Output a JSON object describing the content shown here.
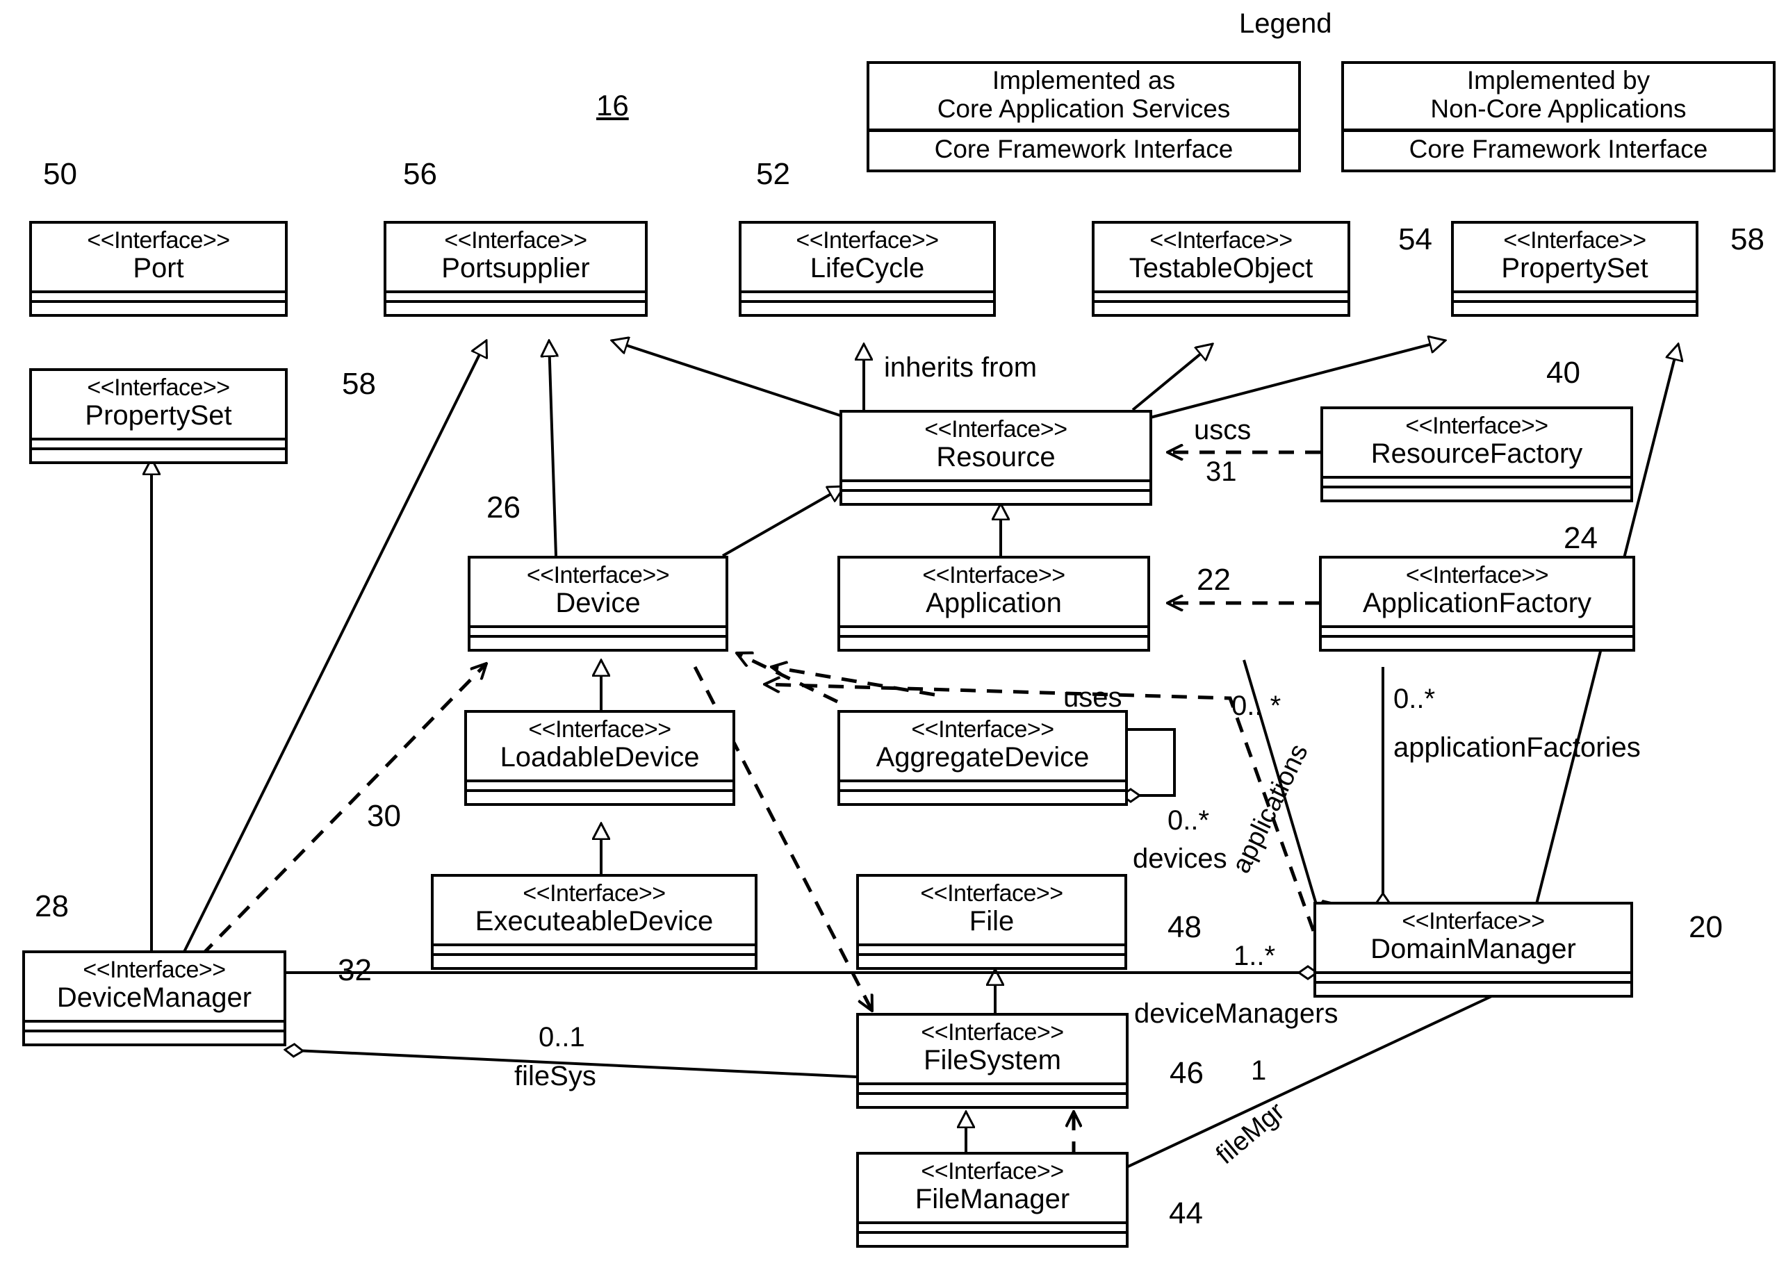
{
  "figure": {
    "number": "16"
  },
  "legend": {
    "title": "Legend",
    "boxes": [
      {
        "line1": "Implemented as",
        "line2": "Core Application Services",
        "footer": "Core Framework Interface"
      },
      {
        "line1": "Implemented by",
        "line2": "Non-Core Applications",
        "footer": "Core Framework Interface"
      }
    ]
  },
  "stereotype": "<<Interface>>",
  "interfaces": [
    {
      "id": "port",
      "name": "Port",
      "ref": "50"
    },
    {
      "id": "portsupplier",
      "name": "Portsupplier",
      "ref": "56"
    },
    {
      "id": "lifecycle",
      "name": "LifeCycle",
      "ref": "52"
    },
    {
      "id": "testableobject",
      "name": "TestableObject",
      "ref": "54"
    },
    {
      "id": "propertyset-right",
      "name": "PropertySet",
      "ref": "58"
    },
    {
      "id": "propertyset-left",
      "name": "PropertySet",
      "ref": "58"
    },
    {
      "id": "resource",
      "name": "Resource",
      "ref": ""
    },
    {
      "id": "resourcefactory",
      "name": "ResourceFactory",
      "ref": "40"
    },
    {
      "id": "device",
      "name": "Device",
      "ref": "26"
    },
    {
      "id": "application",
      "name": "Application",
      "ref": "22"
    },
    {
      "id": "applicationfactory",
      "name": "ApplicationFactory",
      "ref": "24"
    },
    {
      "id": "loadabledevice",
      "name": "LoadableDevice",
      "ref": "30"
    },
    {
      "id": "aggregatedevice",
      "name": "AggregateDevice",
      "ref": ""
    },
    {
      "id": "executeabledevice",
      "name": "ExecuteableDevice",
      "ref": "32"
    },
    {
      "id": "file",
      "name": "File",
      "ref": "48"
    },
    {
      "id": "domainmanager",
      "name": "DomainManager",
      "ref": "20"
    },
    {
      "id": "devicemanager",
      "name": "DeviceManager",
      "ref": "28"
    },
    {
      "id": "filesystem",
      "name": "FileSystem",
      "ref": "46"
    },
    {
      "id": "filemanager",
      "name": "FileManager",
      "ref": "44"
    }
  ],
  "edge_labels": {
    "inherits_from": "inherits from",
    "uses_resource": "uscs",
    "uses_resource_ref": "31",
    "uses_aggregate": "uses",
    "devices_mult": "0..*",
    "devices_role": "devices",
    "applications_mult": "0.. *",
    "applications_role": "applications",
    "application_factories_mult": "0..*",
    "application_factories_role": "applicationFactories",
    "device_managers_mult": "1..*",
    "device_managers_role": "deviceManagers",
    "file_sys_mult": "0..1",
    "file_sys_role": "fileSys",
    "file_mgr_mult": "1",
    "file_mgr_role": "fileMgr"
  },
  "colors": {
    "stroke": "#000000",
    "background": "#ffffff"
  }
}
